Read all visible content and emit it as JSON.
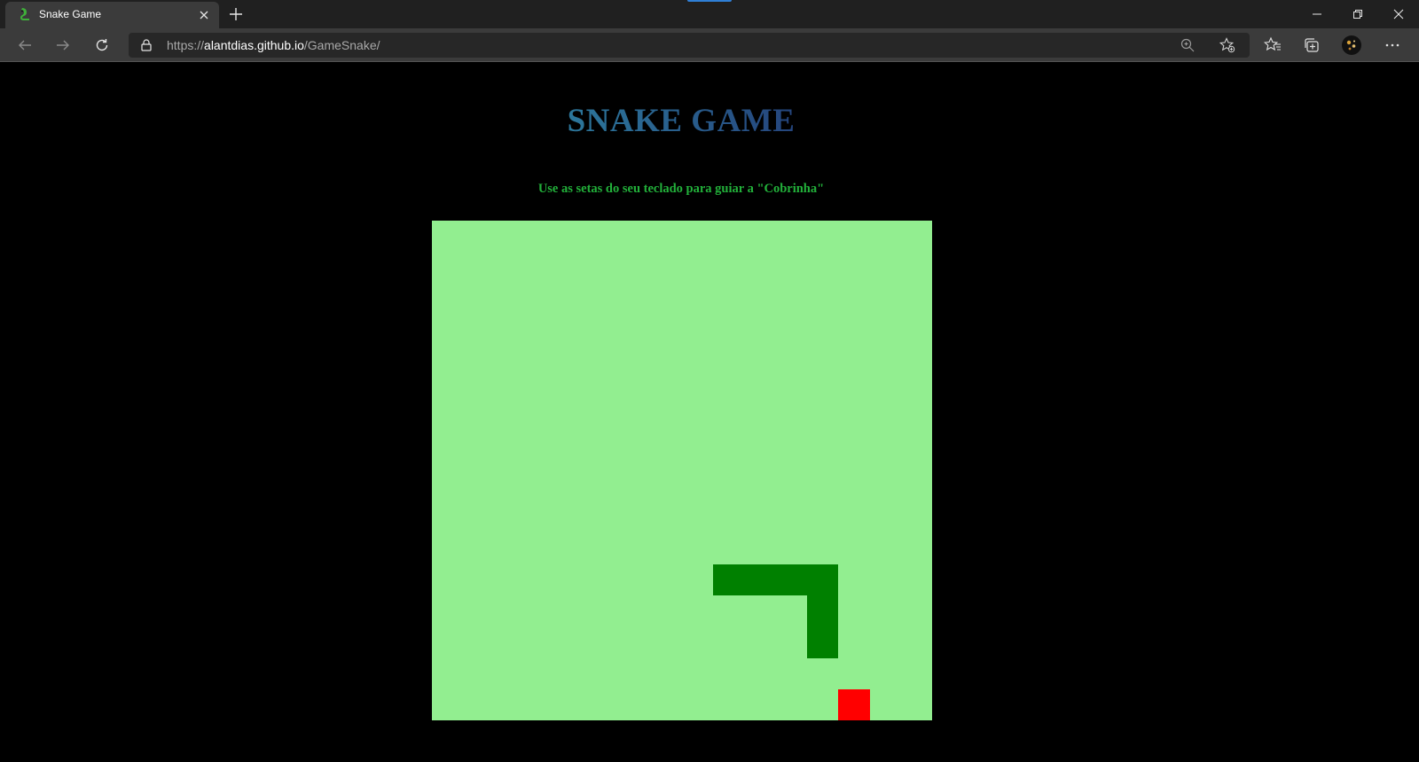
{
  "browser": {
    "tab": {
      "title": "Snake Game",
      "favicon": "snake-icon"
    },
    "url": {
      "scheme": "https://",
      "host": "alantdias.github.io",
      "path": "/GameSnake/"
    },
    "icons": [
      "back-icon",
      "forward-icon",
      "reload-icon",
      "lock-icon",
      "zoom-icon",
      "add-favorite-icon",
      "favorites-icon",
      "collections-icon",
      "profile-avatar",
      "more-icon",
      "minimize-icon",
      "restore-icon",
      "close-icon",
      "new-tab-icon"
    ]
  },
  "game": {
    "title": "SNAKE GAME",
    "instructions": "Use as setas do seu teclado para guiar a \"Cobrinha\"",
    "board_color": "#92ee90",
    "snake_color": "#008000",
    "food_color": "#ff0000",
    "grid_cells": 16,
    "snake_cells": [
      [
        9,
        11
      ],
      [
        10,
        11
      ],
      [
        11,
        11
      ],
      [
        12,
        11
      ],
      [
        12,
        12
      ],
      [
        12,
        13
      ]
    ],
    "food_cell": [
      13,
      15
    ]
  }
}
